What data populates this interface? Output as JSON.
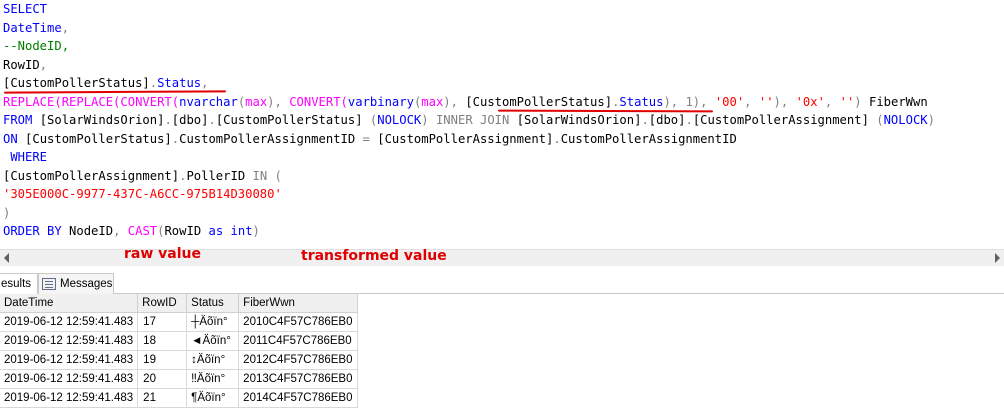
{
  "editor": {
    "lines": [
      {
        "segments": [
          {
            "t": "SELECT",
            "c": "kw"
          }
        ]
      },
      {
        "segments": [
          {
            "t": "DateTime",
            "c": "kw"
          },
          {
            "t": ",",
            "c": "gr"
          }
        ]
      },
      {
        "segments": [
          {
            "t": "--NodeID,",
            "c": "cm"
          }
        ]
      },
      {
        "segments": [
          {
            "t": "RowID",
            "c": ""
          },
          {
            "t": ",",
            "c": "gr"
          }
        ]
      },
      {
        "segments": [
          {
            "t": "[CustomPollerStatus]",
            "c": ""
          },
          {
            "t": ".",
            "c": "gr"
          },
          {
            "t": "Status",
            "c": "kw"
          },
          {
            "t": ",",
            "c": "gr"
          }
        ]
      },
      {
        "segments": [
          {
            "t": "REPLACE(REPLACE(CONVERT(",
            "c": "fn"
          },
          {
            "t": "nvarchar",
            "c": "kw"
          },
          {
            "t": "(",
            "c": "gr"
          },
          {
            "t": "max",
            "c": "fn"
          },
          {
            "t": "), ",
            "c": "gr"
          },
          {
            "t": "CONVERT(",
            "c": "fn"
          },
          {
            "t": "varbinary",
            "c": "kw"
          },
          {
            "t": "(",
            "c": "gr"
          },
          {
            "t": "max",
            "c": "fn"
          },
          {
            "t": "), ",
            "c": "gr"
          },
          {
            "t": "[CustomPollerStatus]",
            "c": "",
            "u": true
          },
          {
            "t": ".",
            "c": "gr",
            "u": true
          },
          {
            "t": "Status",
            "c": "kw",
            "u": true
          },
          {
            "t": ")",
            "c": "gr"
          },
          {
            "t": ", 1), ",
            "c": "gr"
          },
          {
            "t": "'00'",
            "c": "str"
          },
          {
            "t": ", ",
            "c": "gr"
          },
          {
            "t": "''",
            "c": "str"
          },
          {
            "t": "), ",
            "c": "gr"
          },
          {
            "t": "'0x'",
            "c": "str"
          },
          {
            "t": ", ",
            "c": "gr"
          },
          {
            "t": "''",
            "c": "str"
          },
          {
            "t": ") ",
            "c": "gr"
          },
          {
            "t": "FiberWwn",
            "c": ""
          }
        ]
      },
      {
        "segments": [
          {
            "t": "FROM ",
            "c": "kw"
          },
          {
            "t": "[SolarWindsOrion]",
            "c": ""
          },
          {
            "t": ".",
            "c": "gr"
          },
          {
            "t": "[dbo]",
            "c": ""
          },
          {
            "t": ".",
            "c": "gr"
          },
          {
            "t": "[CustomPollerStatus] ",
            "c": ""
          },
          {
            "t": "(",
            "c": "gr"
          },
          {
            "t": "NOLOCK",
            "c": "kw"
          },
          {
            "t": ") ",
            "c": "gr"
          },
          {
            "t": "INNER JOIN ",
            "c": "gr"
          },
          {
            "t": "[SolarWindsOrion]",
            "c": ""
          },
          {
            "t": ".",
            "c": "gr"
          },
          {
            "t": "[dbo]",
            "c": ""
          },
          {
            "t": ".",
            "c": "gr"
          },
          {
            "t": "[CustomPollerAssignment] ",
            "c": ""
          },
          {
            "t": "(",
            "c": "gr"
          },
          {
            "t": "NOLOCK",
            "c": "kw"
          },
          {
            "t": ")",
            "c": "gr"
          }
        ]
      },
      {
        "segments": [
          {
            "t": "ON ",
            "c": "kw"
          },
          {
            "t": "[CustomPollerStatus]",
            "c": ""
          },
          {
            "t": ".",
            "c": "gr"
          },
          {
            "t": "CustomPollerAssignmentID ",
            "c": ""
          },
          {
            "t": "= ",
            "c": "gr"
          },
          {
            "t": "[CustomPollerAssignment]",
            "c": ""
          },
          {
            "t": ".",
            "c": "gr"
          },
          {
            "t": "CustomPollerAssignmentID",
            "c": ""
          }
        ]
      },
      {
        "segments": [
          {
            "t": " WHERE",
            "c": "kw"
          }
        ]
      },
      {
        "segments": [
          {
            "t": "[CustomPollerAssignment]",
            "c": ""
          },
          {
            "t": ".",
            "c": "gr"
          },
          {
            "t": "PollerID ",
            "c": ""
          },
          {
            "t": "IN ",
            "c": "gr"
          },
          {
            "t": "(",
            "c": "gr"
          }
        ]
      },
      {
        "segments": [
          {
            "t": "'305E000C-9977-437C-A6CC-975B14D30080'",
            "c": "str"
          }
        ]
      },
      {
        "segments": [
          {
            "t": ")",
            "c": "gr"
          }
        ]
      },
      {
        "segments": [
          {
            "t": "ORDER BY ",
            "c": "kw"
          },
          {
            "t": "NodeID",
            "c": ""
          },
          {
            "t": ", ",
            "c": "gr"
          },
          {
            "t": "CAST",
            "c": "fn"
          },
          {
            "t": "(",
            "c": "gr"
          },
          {
            "t": "RowID ",
            "c": ""
          },
          {
            "t": "as ",
            "c": "kw"
          },
          {
            "t": "int",
            "c": "kw"
          },
          {
            "t": ")",
            "c": "gr"
          }
        ]
      }
    ]
  },
  "annotations": {
    "raw_value": "raw value",
    "transformed_value": "transformed value"
  },
  "tabs": {
    "results": "esults",
    "messages": "Messages"
  },
  "grid": {
    "columns": [
      "DateTime",
      "RowID",
      "Status",
      "FiberWwn"
    ],
    "rows": [
      [
        "2019-06-12 12:59:41.483",
        "17",
        "┼Äõïn°",
        "2010C4F57C786EB0"
      ],
      [
        "2019-06-12 12:59:41.483",
        "18",
        "◄Äõïn°",
        "2011C4F57C786EB0"
      ],
      [
        "2019-06-12 12:59:41.483",
        "19",
        "↕Äõïn°",
        "2012C4F57C786EB0"
      ],
      [
        "2019-06-12 12:59:41.483",
        "20",
        "‼Äõïn°",
        "2013C4F57C786EB0"
      ],
      [
        "2019-06-12 12:59:41.483",
        "21",
        "¶Äõïn°",
        "2014C4F57C786EB0"
      ]
    ]
  },
  "colors": {
    "keyword": "#0000ff",
    "function": "#ff00ff",
    "string": "#ff0000",
    "comment": "#008000",
    "annotation": "#e00000"
  }
}
